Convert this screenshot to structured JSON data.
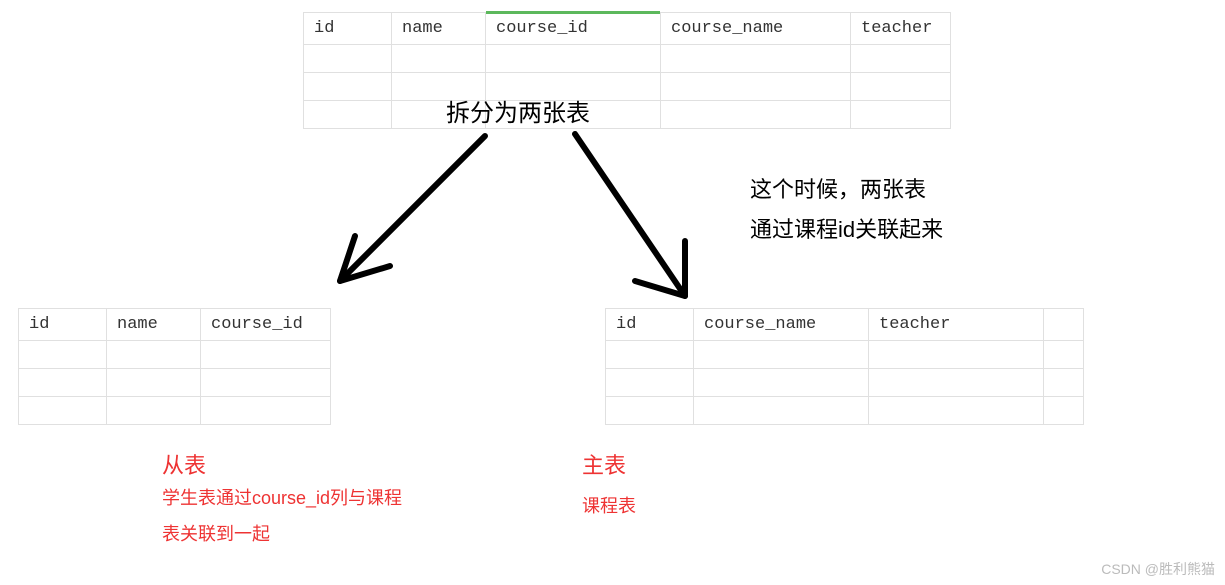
{
  "top_table": {
    "headers": [
      "id",
      "name",
      "course_id",
      "course_name",
      "teacher"
    ],
    "highlight_col": 2
  },
  "split_label": "拆分为两张表",
  "annotation": {
    "line1": "这个时候，两张表",
    "line2": "通过课程id关联起来"
  },
  "left_table": {
    "headers": [
      "id",
      "name",
      "course_id"
    ]
  },
  "right_table": {
    "headers": [
      "id",
      "course_name",
      "teacher"
    ]
  },
  "left_caption": {
    "title": "从表",
    "desc1": "学生表通过course_id列与课程",
    "desc2": "表关联到一起"
  },
  "right_caption": {
    "title": "主表",
    "desc": "课程表"
  },
  "watermark": "CSDN @胜利熊猫"
}
